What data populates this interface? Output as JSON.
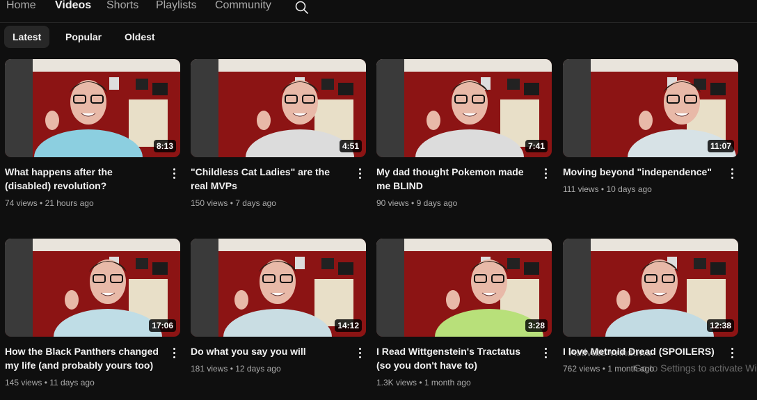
{
  "tabs": {
    "home": "Home",
    "videos": "Videos",
    "shorts": "Shorts",
    "playlists": "Playlists",
    "community": "Community"
  },
  "search_icon": "search-icon",
  "chips": {
    "latest": "Latest",
    "popular": "Popular",
    "oldest": "Oldest"
  },
  "videos": [
    {
      "title": "What happens after the (disabled) revolution?",
      "views": "74 views",
      "age": "21 hours ago",
      "duration": "8:13"
    },
    {
      "title": "\"Childless Cat Ladies\" are the real MVPs",
      "views": "150 views",
      "age": "7 days ago",
      "duration": "4:51"
    },
    {
      "title": "My dad thought Pokemon made me BLIND",
      "views": "90 views",
      "age": "9 days ago",
      "duration": "7:41"
    },
    {
      "title": "Moving beyond \"independence\"",
      "views": "111 views",
      "age": "10 days ago",
      "duration": "11:07"
    },
    {
      "title": "How the Black Panthers changed my life (and probably yours too)",
      "views": "145 views",
      "age": "11 days ago",
      "duration": "17:06"
    },
    {
      "title": "Do what you say you will",
      "views": "181 views",
      "age": "12 days ago",
      "duration": "14:12"
    },
    {
      "title": "I Read Wittgenstein's Tractatus (so you don't have to)",
      "views": "1.3K views",
      "age": "1 month ago",
      "duration": "3:28"
    },
    {
      "title": "I love Metroid Dread (SPOILERS)",
      "views": "762 views",
      "age": "1 month ago",
      "duration": "12:38"
    }
  ],
  "meta_separator": " • ",
  "watermark": {
    "line1": "Activate Windows",
    "line2": "Go to Settings to activate Windows."
  },
  "colors": {
    "background": "#0f0f0f",
    "wall_red": "#8c1414",
    "chip_active": "#272727",
    "secondary_text": "#aaaaaa"
  }
}
